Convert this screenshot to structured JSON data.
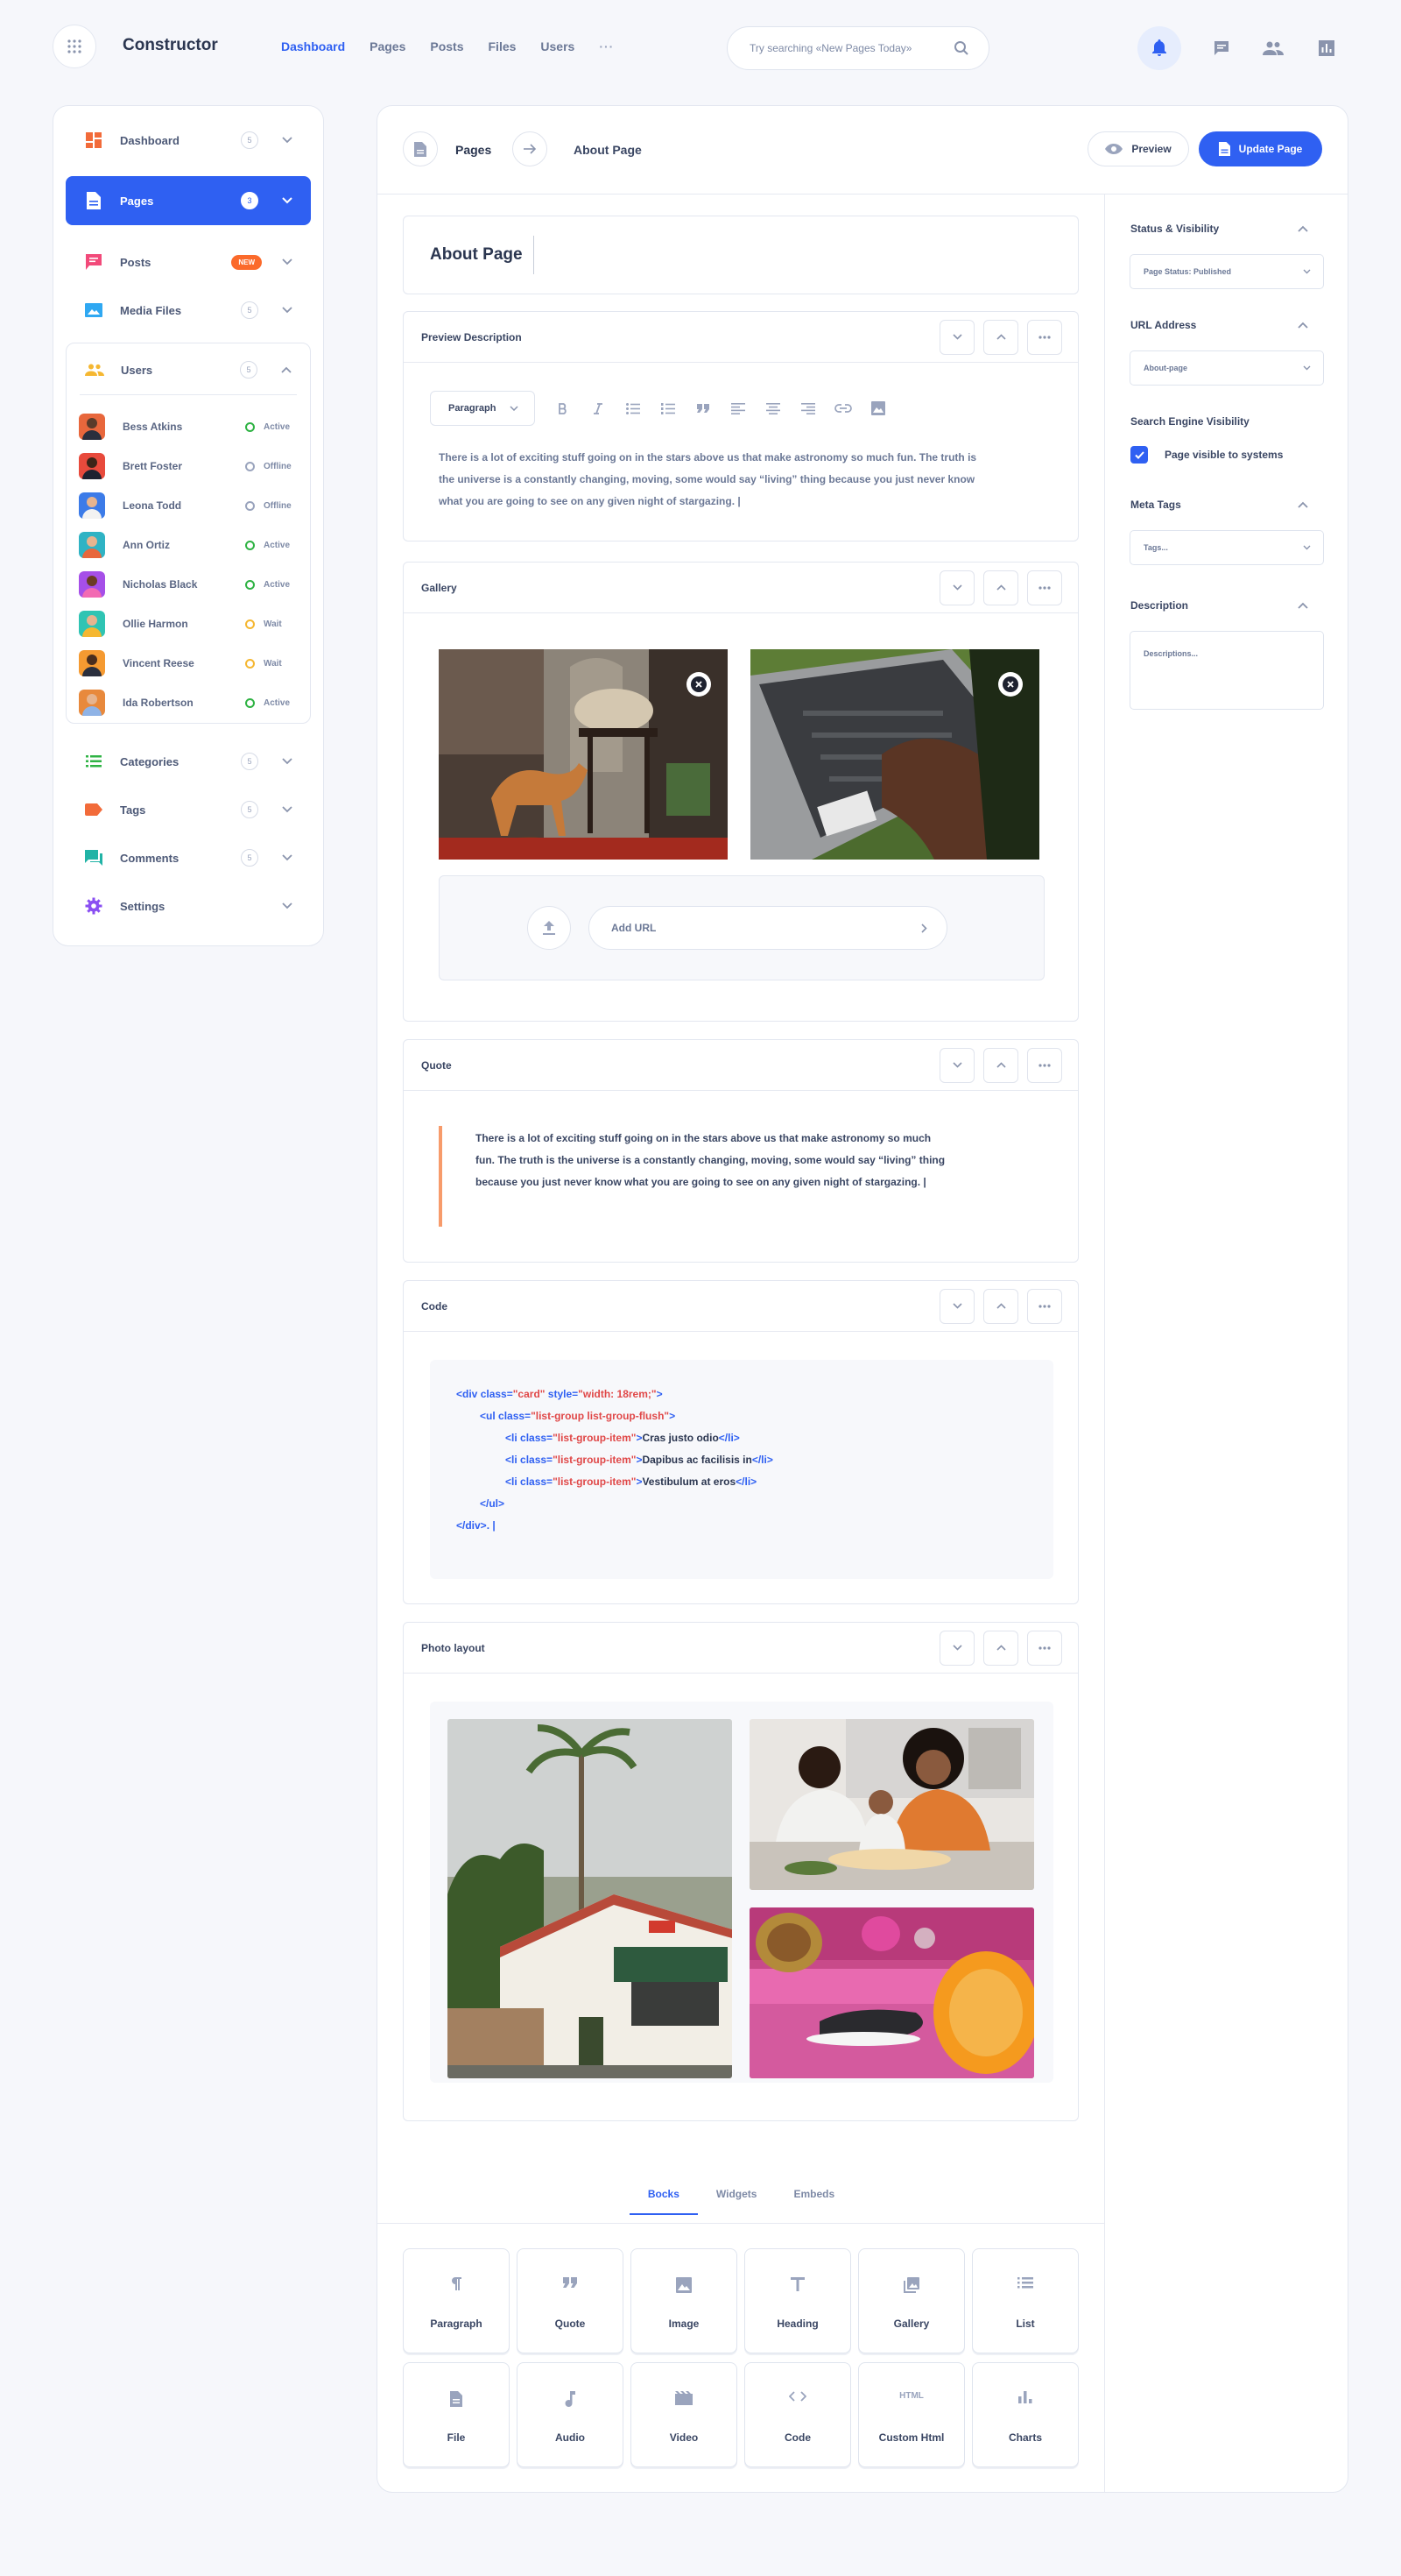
{
  "app": {
    "name": "Constructor"
  },
  "topnav": {
    "items": [
      "Dashboard",
      "Pages",
      "Posts",
      "Files",
      "Users"
    ],
    "more": "···"
  },
  "search": {
    "placeholder": "Try searching «New Pages Today»"
  },
  "sidebar": {
    "items": [
      {
        "label": "Dashboard",
        "count": "5",
        "icon": "dashboard-icon",
        "color": "#f26b3a"
      },
      {
        "label": "Pages",
        "count": "3",
        "icon": "page-icon",
        "active": true
      },
      {
        "label": "Posts",
        "badge": "NEW",
        "icon": "posts-icon",
        "color": "#f24a7a"
      },
      {
        "label": "Media Files",
        "count": "5",
        "icon": "image-icon",
        "color": "#2fa8f2"
      },
      {
        "label": "Users",
        "count": "5",
        "icon": "users-icon",
        "color": "#f5b731"
      },
      {
        "label": "Categories",
        "count": "5",
        "icon": "list-icon",
        "color": "#2fb344"
      },
      {
        "label": "Tags",
        "count": "5",
        "icon": "tag-icon",
        "color": "#f26b3a"
      },
      {
        "label": "Comments",
        "count": "5",
        "icon": "comments-icon",
        "color": "#21b3a6"
      },
      {
        "label": "Settings",
        "icon": "gear-icon",
        "color": "#8a4ff2"
      }
    ],
    "users": [
      {
        "name": "Bess Atkins",
        "status": "Active",
        "status_color": "#2fb344",
        "avatar_color": "#e8673c"
      },
      {
        "name": "Brett Foster",
        "status": "Offline",
        "status_color": "#9aa4bd",
        "avatar_color": "#e84a3c"
      },
      {
        "name": "Leona Todd",
        "status": "Offline",
        "status_color": "#9aa4bd",
        "avatar_color": "#3c7be8"
      },
      {
        "name": "Ann Ortiz",
        "status": "Active",
        "status_color": "#2fb344",
        "avatar_color": "#2fb3c4"
      },
      {
        "name": "Nicholas Black",
        "status": "Active",
        "status_color": "#2fb344",
        "avatar_color": "#a64fe8"
      },
      {
        "name": "Ollie Harmon",
        "status": "Wait",
        "status_color": "#f5b731",
        "avatar_color": "#2fc4b3"
      },
      {
        "name": "Vincent Reese",
        "status": "Wait",
        "status_color": "#f5b731",
        "avatar_color": "#f59a31"
      },
      {
        "name": "Ida Robertson",
        "status": "Active",
        "status_color": "#2fb344",
        "avatar_color": "#e8893c"
      }
    ]
  },
  "header": {
    "crumb_root": "Pages",
    "crumb_current": "About Page",
    "preview_label": "Preview",
    "update_label": "Update Page"
  },
  "editor": {
    "title": "About Page",
    "preview_description": {
      "title": "Preview Description",
      "format": "Paragraph",
      "lines": [
        "There is a lot of exciting stuff going on in the stars above us that make astronomy so much fun. The truth is",
        "the universe is a constantly changing, moving, some would say “living” thing because you just never know",
        "what you are going to see on any given night of stargazing. |"
      ]
    },
    "gallery": {
      "title": "Gallery",
      "url_placeholder": "Add URL"
    },
    "quote": {
      "title": "Quote",
      "lines": [
        "There is a lot of exciting stuff going on in the stars above us that make astronomy so much",
        "fun. The truth is the universe is a constantly changing, moving, some would say “living” thing",
        "because you just never know what you are going to see on any given night of stargazing. |"
      ]
    },
    "code": {
      "title": "Code",
      "l1_open": "<div ",
      "l1_a1": "class=",
      "l1_v1": "\"card\"",
      "l1_a2": " style=",
      "l1_v2": "\"width: 18rem;\"",
      "l1_close": ">",
      "l2_open": "<ul ",
      "l2_a": "class=",
      "l2_v": "\"list-group list-group-flush\"",
      "l2_close": ">",
      "li_open": "<li ",
      "li_a": "class=",
      "li_v": "\"list-group-item\"",
      "li_gt": ">",
      "li_end": "</li>",
      "items": [
        "Cras justo odio",
        "Dapibus ac facilisis in",
        "Vestibulum at eros"
      ],
      "l6": "</ul>",
      "l7": "</div>. |"
    },
    "photo_layout": {
      "title": "Photo layout"
    }
  },
  "tabs": [
    "Bocks",
    "Widgets",
    "Embeds"
  ],
  "blocks": [
    {
      "label": "Paragraph",
      "icon": "paragraph-icon"
    },
    {
      "label": "Quote",
      "icon": "quote-icon"
    },
    {
      "label": "Image",
      "icon": "image-icon"
    },
    {
      "label": "Heading",
      "icon": "heading-icon"
    },
    {
      "label": "Gallery",
      "icon": "gallery-icon"
    },
    {
      "label": "List",
      "icon": "list-icon"
    },
    {
      "label": "File",
      "icon": "file-icon"
    },
    {
      "label": "Audio",
      "icon": "audio-icon"
    },
    {
      "label": "Video",
      "icon": "video-icon"
    },
    {
      "label": "Code",
      "icon": "code-icon"
    },
    {
      "label": "Custom Html",
      "icon": "html-icon",
      "icon_text": "HTML"
    },
    {
      "label": "Charts",
      "icon": "chart-icon"
    }
  ],
  "right_panel": {
    "status_visibility": {
      "label": "Status & Visibility",
      "value": "Page Status: Published"
    },
    "url_address": {
      "label": "URL Address",
      "value": "About-page"
    },
    "seo": {
      "label": "Search Engine Visibility",
      "checkbox_label": "Page visible to systems",
      "checked": true
    },
    "meta_tags": {
      "label": "Meta Tags",
      "placeholder": "Tags..."
    },
    "description": {
      "label": "Description",
      "placeholder": "Descriptions..."
    }
  },
  "colors": {
    "accent": "#2f60f2",
    "badge_new": "#fb6a2b"
  }
}
